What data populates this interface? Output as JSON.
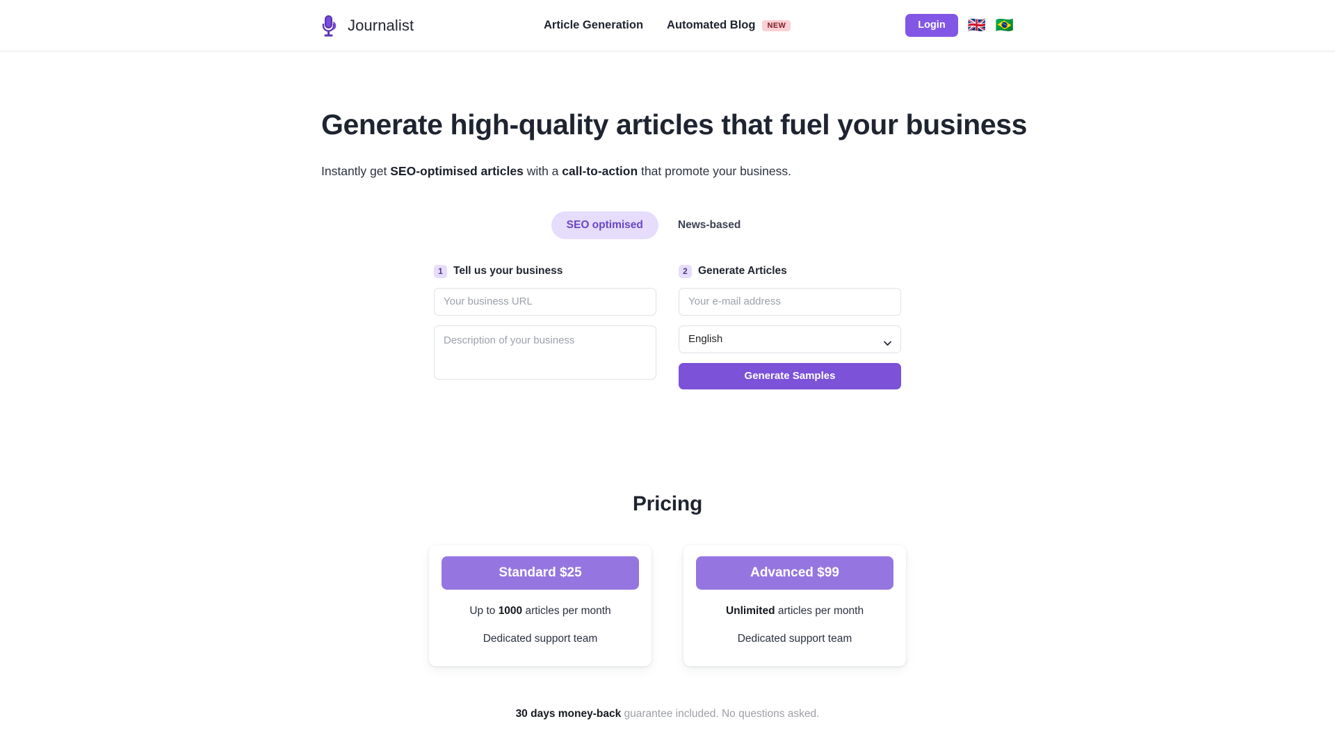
{
  "header": {
    "brand_name": "Journalist",
    "logo_icon": "microphone-icon",
    "nav": [
      {
        "label": "Article Generation",
        "badge": ""
      },
      {
        "label": "Automated Blog",
        "badge": "NEW"
      }
    ],
    "login_label": "Login",
    "flags": [
      {
        "name": "flag-united-kingdom",
        "glyph": "🇬🇧"
      },
      {
        "name": "flag-brazil",
        "glyph": "🇧🇷"
      }
    ],
    "accent_purple": "#8257e5",
    "badge_bg": "#fbd0d4",
    "badge_color": "#7d1f28"
  },
  "hero": {
    "headline": "Generate high-quality articles that fuel your business",
    "subhead": {
      "part1": "Instantly get ",
      "bold1": "SEO-optimised articles",
      "part2": " with a ",
      "bold2": "call-to-action",
      "part3": " that promote your business."
    },
    "tabs": [
      {
        "label": "SEO optimised",
        "active": true
      },
      {
        "label": "News-based",
        "active": false
      }
    ],
    "tab_active_bg": "#e6dcfb",
    "tab_active_color": "#6a46c6"
  },
  "form": {
    "step1": {
      "number": "1",
      "label": "Tell us your business",
      "url_placeholder": "Your business URL",
      "url_value": "",
      "description_placeholder": "Description of your business",
      "description_value": ""
    },
    "step2": {
      "number": "2",
      "label": "Generate Articles",
      "email_placeholder": "Your e-mail address",
      "email_value": "",
      "language_selected": "English",
      "language_options": [
        "English"
      ],
      "submit_label": "Generate Samples",
      "submit_color": "#7b52d8"
    }
  },
  "pricing": {
    "title": "Pricing",
    "plan_button_color": "#9575e0",
    "plans": [
      {
        "name": "Standard $25",
        "feature1_pre": "Up to ",
        "feature1_bold": "1000",
        "feature1_post": " articles per month",
        "feature2": "Dedicated support team"
      },
      {
        "name": "Advanced $99",
        "feature1_pre": "",
        "feature1_bold": "Unlimited",
        "feature1_post": " articles per month",
        "feature2": "Dedicated support team"
      }
    ],
    "guarantee_bold": "30 days money-back",
    "guarantee_rest": " guarantee included. No questions asked."
  }
}
